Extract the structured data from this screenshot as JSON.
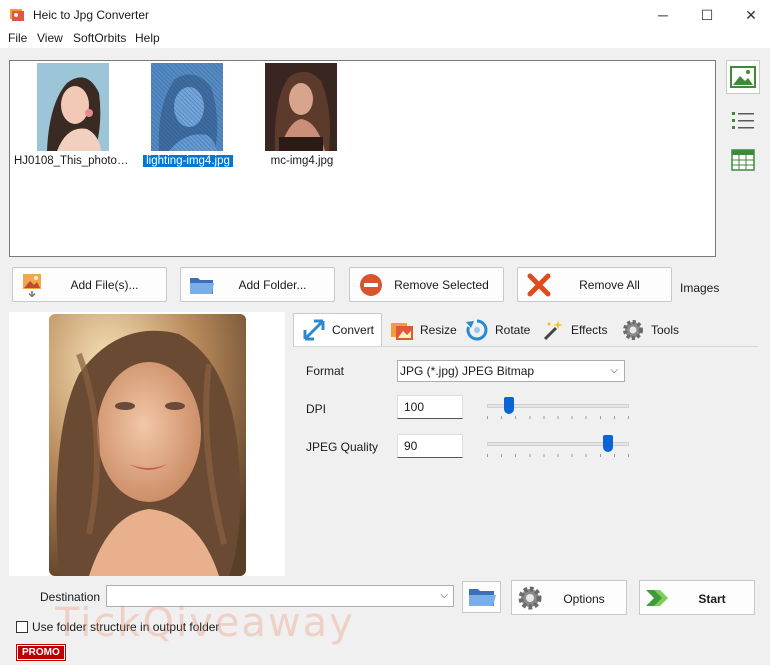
{
  "window": {
    "title": "Heic to Jpg Converter",
    "minimize": "─",
    "maximize": "☐",
    "close": "✕"
  },
  "menu": [
    "File",
    "View",
    "SoftOrbits",
    "Help"
  ],
  "thumbnails": [
    {
      "name": "HJ0108_This_photogr...",
      "selected": false
    },
    {
      "name": "lighting-img4.jpg",
      "selected": true
    },
    {
      "name": "mc-img4.jpg",
      "selected": false
    }
  ],
  "side_icons": [
    "image-view-icon",
    "list-view-icon",
    "table-view-icon"
  ],
  "actions": {
    "add_files": "Add File(s)...",
    "add_folder": "Add Folder...",
    "remove_selected": "Remove Selected",
    "remove_all": "Remove All",
    "images_label": "Images"
  },
  "tabs": [
    "Convert",
    "Resize",
    "Rotate",
    "Effects",
    "Tools"
  ],
  "convert": {
    "format_label": "Format",
    "format_value": "JPG (*.jpg) JPEG Bitmap",
    "dpi_label": "DPI",
    "dpi_value": "100",
    "dpi_slider_level": 0.13,
    "quality_label": "JPEG Quality",
    "quality_value": "90",
    "quality_slider_level": 0.88
  },
  "bottom": {
    "destination_label": "Destination",
    "destination_value": "",
    "options": "Options",
    "start": "Start",
    "folder_structure": "Use folder structure in output folder",
    "promo": "PROMO",
    "watermark": "TickQiveaway"
  },
  "colors": {
    "accent": "#0078d7",
    "promo": "#c00000",
    "slider": "#0a64d6"
  }
}
